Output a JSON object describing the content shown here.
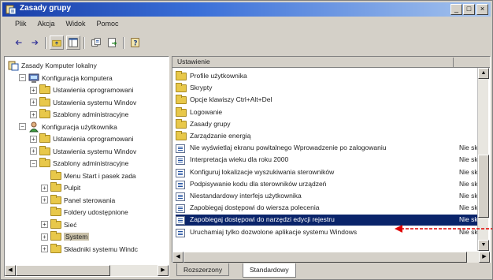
{
  "window": {
    "title": "Zasady grupy",
    "controls": [
      "_",
      "□",
      "×"
    ]
  },
  "menu": [
    "Plik",
    "Akcja",
    "Widok",
    "Pomoc"
  ],
  "tree": [
    {
      "label": "Zasady Komputer lokalny",
      "indent": 0,
      "expander": "",
      "icon": "policy-root-icon"
    },
    {
      "label": "Konfiguracja komputera",
      "indent": 1,
      "expander": "−",
      "icon": "computer-icon"
    },
    {
      "label": "Ustawienia oprogramowani",
      "indent": 2,
      "expander": "+",
      "icon": "folder-icon"
    },
    {
      "label": "Ustawienia systemu Windov",
      "indent": 2,
      "expander": "+",
      "icon": "folder-icon"
    },
    {
      "label": "Szablony administracyjne",
      "indent": 2,
      "expander": "+",
      "icon": "folder-icon"
    },
    {
      "label": "Konfiguracja użytkownika",
      "indent": 1,
      "expander": "−",
      "icon": "user-icon"
    },
    {
      "label": "Ustawienia oprogramowani",
      "indent": 2,
      "expander": "+",
      "icon": "folder-icon"
    },
    {
      "label": "Ustawienia systemu Windov",
      "indent": 2,
      "expander": "+",
      "icon": "folder-icon"
    },
    {
      "label": "Szablony administracyjne",
      "indent": 2,
      "expander": "−",
      "icon": "folder-icon"
    },
    {
      "label": "Menu Start i pasek zada",
      "indent": 3,
      "expander": "",
      "icon": "folder-icon"
    },
    {
      "label": "Pulpit",
      "indent": 3,
      "expander": "+",
      "icon": "folder-icon"
    },
    {
      "label": "Panel sterowania",
      "indent": 3,
      "expander": "+",
      "icon": "folder-icon"
    },
    {
      "label": "Foldery udostępnione",
      "indent": 3,
      "expander": "",
      "icon": "folder-icon"
    },
    {
      "label": "Sieć",
      "indent": 3,
      "expander": "+",
      "icon": "folder-icon"
    },
    {
      "label": "System",
      "indent": 3,
      "expander": "+",
      "icon": "folder-icon",
      "selected": true
    },
    {
      "label": "Składniki systemu Windc",
      "indent": 3,
      "expander": "+",
      "icon": "folder-icon"
    }
  ],
  "list": {
    "header": {
      "name": "Ustawienie",
      "state": ""
    },
    "rows": [
      {
        "name": "Profile użytkownika",
        "state": "",
        "icon": "folder-icon"
      },
      {
        "name": "Skrypty",
        "state": "",
        "icon": "folder-icon"
      },
      {
        "name": "Opcje klawiszy Ctrl+Alt+Del",
        "state": "",
        "icon": "folder-icon"
      },
      {
        "name": "Logowanie",
        "state": "",
        "icon": "folder-icon"
      },
      {
        "name": "Zasady grupy",
        "state": "",
        "icon": "folder-icon"
      },
      {
        "name": "Zarządzanie energią",
        "state": "",
        "icon": "folder-icon"
      },
      {
        "name": "Nie wyświetlaj ekranu powitalnego Wprowadzenie po zalogowaniu",
        "state": "Nie sk",
        "icon": "policy-icon"
      },
      {
        "name": "Interpretacja wieku dla roku 2000",
        "state": "Nie sk",
        "icon": "policy-icon"
      },
      {
        "name": "Konfiguruj lokalizacje wyszukiwania sterowników",
        "state": "Nie sk",
        "icon": "policy-icon"
      },
      {
        "name": "Podpisywanie kodu dla sterowników urządzeń",
        "state": "Nie sk",
        "icon": "policy-icon"
      },
      {
        "name": "Niestandardowy interfejs użytkownika",
        "state": "Nie sk",
        "icon": "policy-icon"
      },
      {
        "name": "Zapobiegaj dostępowi do wiersza polecenia",
        "state": "Nie sk",
        "icon": "policy-icon"
      },
      {
        "name": "Zapobiegaj dostępowi do narzędzi edycji rejestru",
        "state": "Nie sk",
        "icon": "policy-icon",
        "selected": true
      },
      {
        "name": "Uruchamiaj tylko dozwolone aplikacje systemu Windows",
        "state": "Nie sk",
        "icon": "policy-icon"
      }
    ]
  },
  "tabs": [
    {
      "label": "Rozszerzony",
      "active": false
    },
    {
      "label": "Standardowy",
      "active": true
    }
  ],
  "colors": {
    "selection": "#0a246a",
    "annotation_arrow": "#e00000"
  }
}
